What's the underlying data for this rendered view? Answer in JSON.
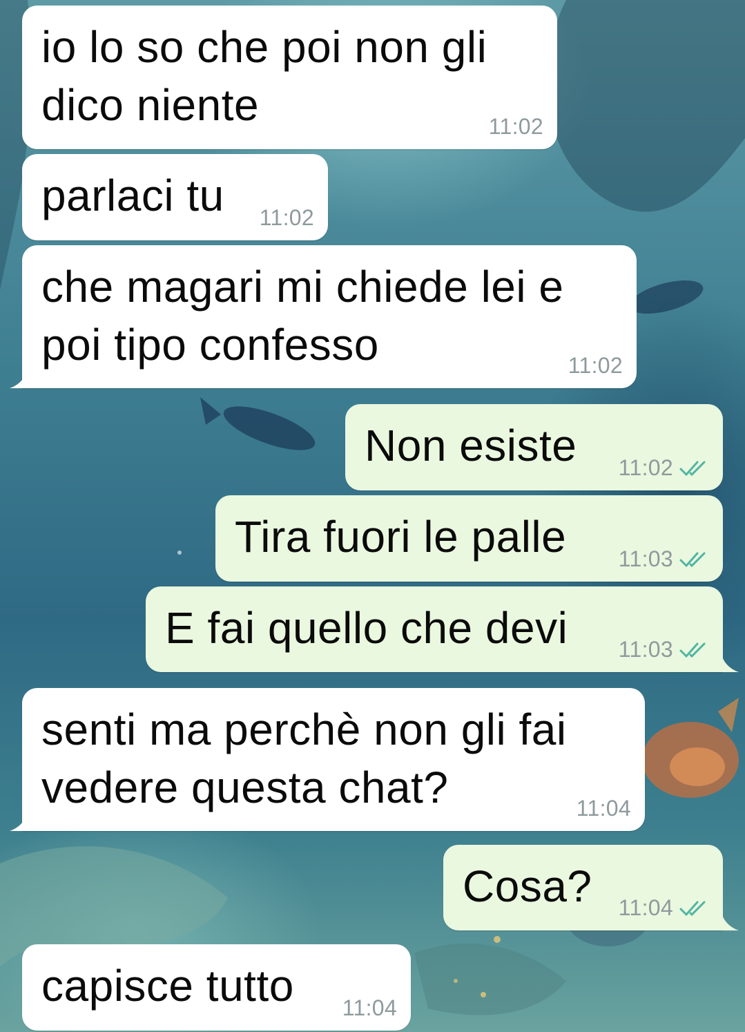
{
  "messages": [
    {
      "direction": "incoming",
      "text": "io lo so che poi non gli\ndico niente",
      "time": "11:02"
    },
    {
      "direction": "incoming",
      "text": "parlaci tu",
      "time": "11:02"
    },
    {
      "direction": "incoming",
      "text": "che magari mi chiede lei e\npoi tipo confesso",
      "time": "11:02"
    },
    {
      "direction": "outgoing",
      "text": "Non esiste",
      "time": "11:02",
      "status": "read"
    },
    {
      "direction": "outgoing",
      "text": "Tira fuori le palle",
      "time": "11:03",
      "status": "read"
    },
    {
      "direction": "outgoing",
      "text": "E fai quello che devi",
      "time": "11:03",
      "status": "read"
    },
    {
      "direction": "incoming",
      "text": "senti ma perchè non gli fai\nvedere questa chat?",
      "time": "11:04"
    },
    {
      "direction": "outgoing",
      "text": "Cosa?",
      "time": "11:04",
      "status": "read"
    },
    {
      "direction": "incoming",
      "text": "capisce tutto",
      "time": "11:04"
    }
  ],
  "colors": {
    "incoming_bubble": "#ffffff",
    "outgoing_bubble": "#eaf8df",
    "timestamp": "#8e9a9c",
    "read_ticks": "#4fb5a2"
  },
  "icons": {
    "read_status": "double-check-icon"
  }
}
